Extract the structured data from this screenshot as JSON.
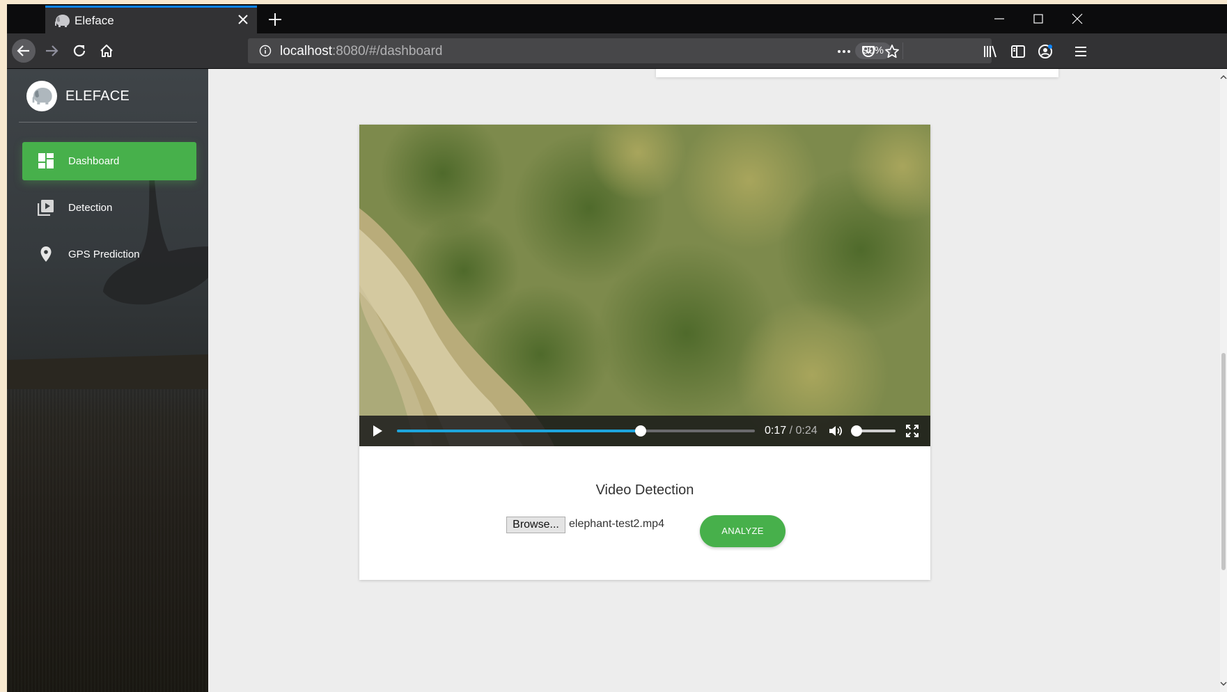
{
  "browser": {
    "tab_title": "Eleface",
    "url_host": "localhost",
    "url_rest": ":8080/#/dashboard",
    "zoom": "90%"
  },
  "sidebar": {
    "brand": "ELEFACE",
    "items": [
      {
        "label": "Dashboard",
        "icon": "dashboard-icon",
        "active": true
      },
      {
        "label": "Detection",
        "icon": "video-library-icon",
        "active": false
      },
      {
        "label": "GPS Prediction",
        "icon": "location-pin-icon",
        "active": false
      }
    ]
  },
  "video": {
    "current_time": "0:17",
    "separator": " / ",
    "duration": "0:24",
    "progress": 0.68,
    "volume": 0.1
  },
  "detection": {
    "title": "Video Detection",
    "browse_label": "Browse...",
    "file_name": "elephant-test2.mp4",
    "analyze_label": "ANALYZE"
  },
  "colors": {
    "accent_green": "#47b04b",
    "progress_blue": "#1ea5dc",
    "tab_highlight": "#0a84ff"
  }
}
